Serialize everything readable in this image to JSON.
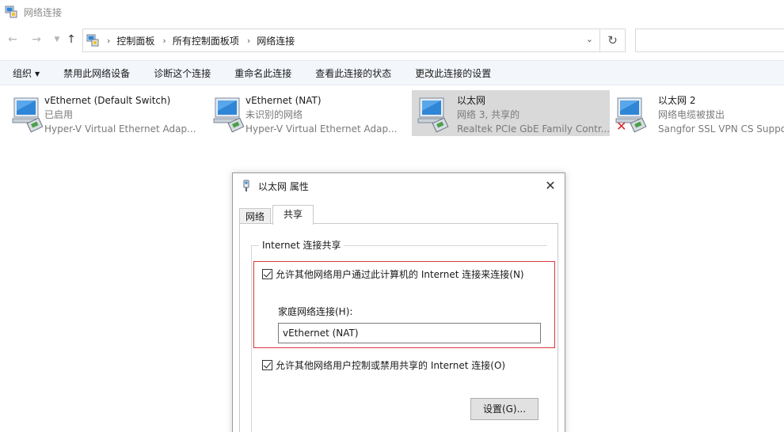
{
  "window": {
    "title": "网络连接"
  },
  "address": {
    "breadcrumbs": [
      "控制面板",
      "所有控制面板项",
      "网络连接"
    ]
  },
  "commands": [
    {
      "label": "组织",
      "has_menu": true
    },
    {
      "label": "禁用此网络设备"
    },
    {
      "label": "诊断这个连接"
    },
    {
      "label": "重命名此连接"
    },
    {
      "label": "查看此连接的状态"
    },
    {
      "label": "更改此连接的设置"
    }
  ],
  "connections": [
    {
      "name": "vEthernet (Default Switch)",
      "status": "已启用",
      "adapter": "Hyper-V Virtual Ethernet Adap...",
      "selected": false,
      "disconnected": false
    },
    {
      "name": "vEthernet (NAT)",
      "status": "未识别的网络",
      "adapter": "Hyper-V Virtual Ethernet Adap...",
      "selected": false,
      "disconnected": false
    },
    {
      "name": "以太网",
      "status": "网络 3, 共享的",
      "adapter": "Realtek PCIe GbE Family Contr...",
      "selected": true,
      "disconnected": false
    },
    {
      "name": "以太网 2",
      "status": "网络电缆被拔出",
      "adapter": "Sangfor SSL VPN CS Support",
      "selected": false,
      "disconnected": true
    }
  ],
  "dialog": {
    "title": "以太网 属性",
    "tabs": [
      "网络",
      "共享"
    ],
    "group_title": "Internet 连接共享",
    "allow_share_label": "允许其他网络用户通过此计算机的 Internet 连接来连接(N)",
    "home_network_label": "家庭网络连接(H):",
    "home_network_value": "vEthernet (NAT)",
    "allow_control_label": "允许其他网络用户控制或禁用共享的 Internet 连接(O)",
    "settings_button": "设置(G)..."
  },
  "colors": {
    "highlight_border": "#d9363e",
    "command_bar_bg": "#f3f6fb",
    "selected_tile_bg": "#d9d9d9",
    "monitor_blue": "#2f86d6"
  }
}
